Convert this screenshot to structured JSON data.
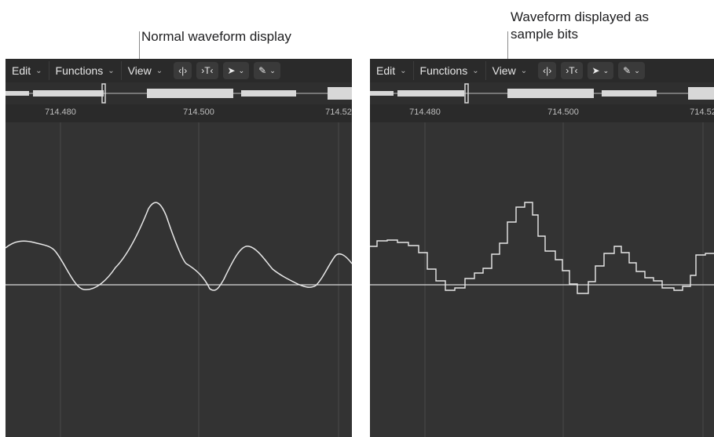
{
  "callouts": {
    "left": "Normal waveform display",
    "right_line1": "Waveform displayed as",
    "right_line2": "sample bits"
  },
  "toolbar": {
    "edit": "Edit",
    "functions": "Functions",
    "view": "View"
  },
  "ruler": {
    "left": [
      "714.480",
      "714.500",
      "714.52"
    ],
    "right": [
      "714.480",
      "714.500",
      "714.52"
    ]
  },
  "colors": {
    "panel_bg": "#333333",
    "waveform": "#e8e8e8",
    "zero_line": "#d9d9d9",
    "grid": "#4a4a4a"
  }
}
